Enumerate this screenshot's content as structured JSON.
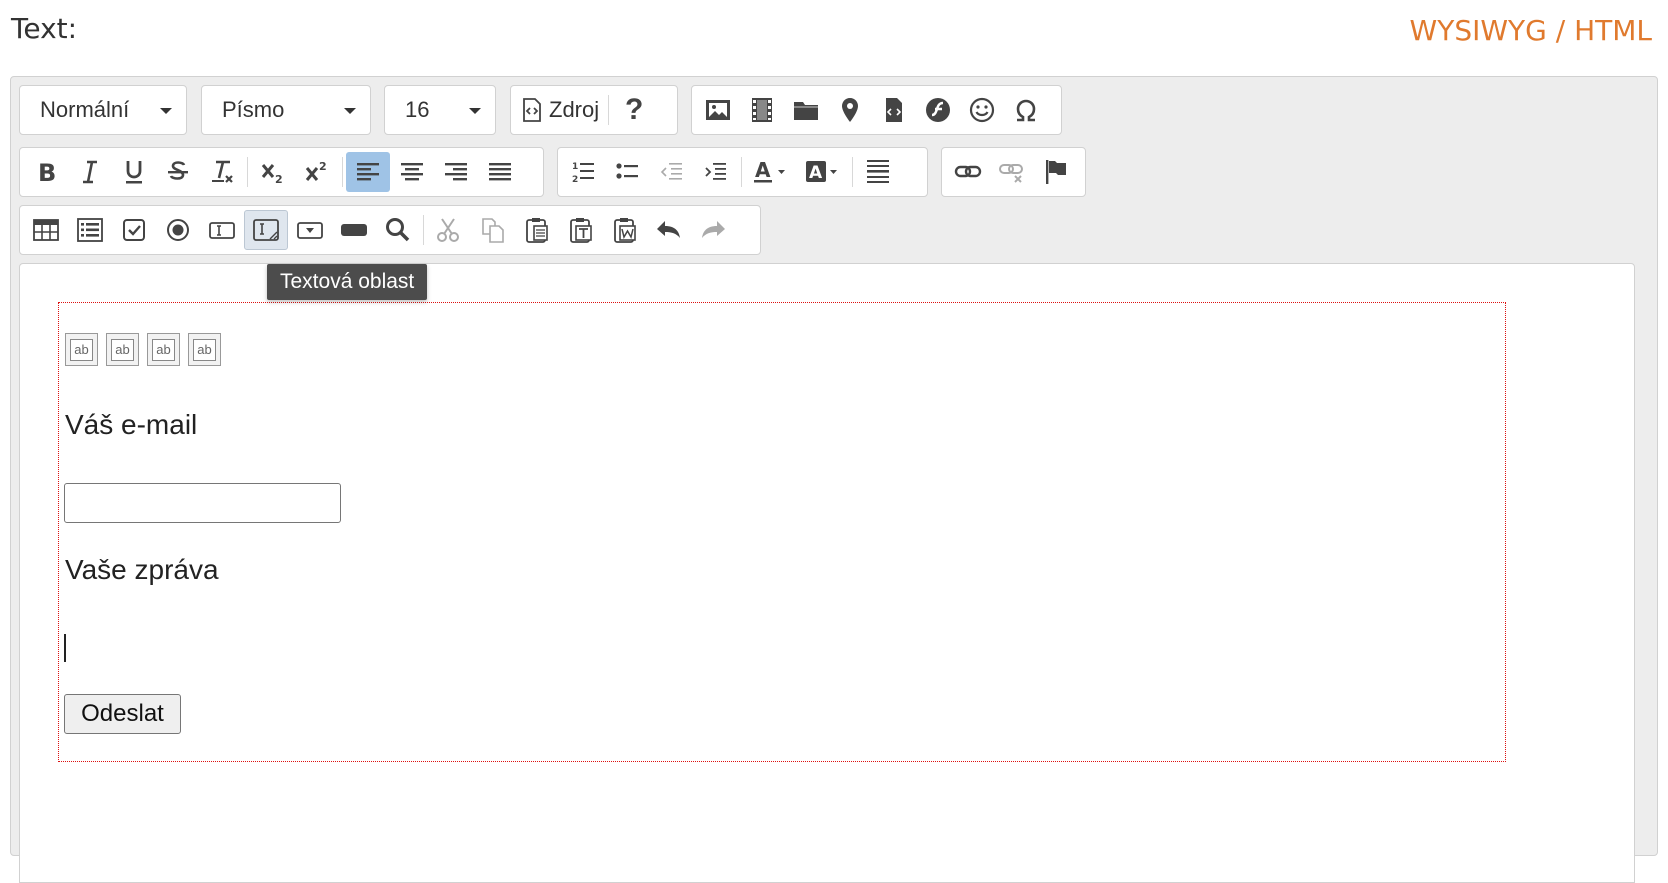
{
  "header": {
    "label": "Text:",
    "mode_toggle": "WYSIWYG / HTML"
  },
  "toolbar": {
    "format_combo": "Normální",
    "font_combo": "Písmo",
    "size_combo": "16",
    "source_label": "Zdroj",
    "help_glyph": "?"
  },
  "tooltip": "Textová oblast",
  "form": {
    "hidden_field_text": "ab",
    "email_label": "Váš e-mail",
    "message_label": "Vaše zpráva",
    "submit_label": "Odeslat"
  },
  "colors": {
    "accent": "#e07a2e",
    "form_border": "#dd1111",
    "active_button": "#9fc3e6"
  }
}
